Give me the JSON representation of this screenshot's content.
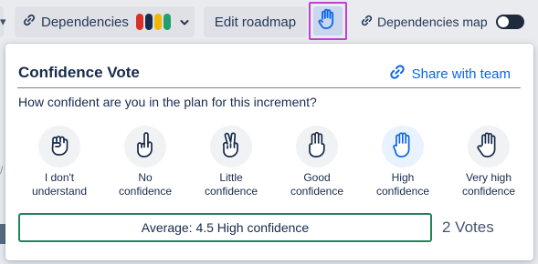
{
  "toolbar": {
    "edge_glyph": "▾",
    "dependencies_label": "Dependencies",
    "dependency_colors": [
      "#d93025",
      "#172b4d",
      "#f2b705",
      "#22a06b"
    ],
    "edit_roadmap_label": "Edit roadmap",
    "dependencies_map_label": "Dependencies map",
    "dependencies_map_enabled": false,
    "hand_button_color": "#0c66e4",
    "highlight_color": "#bf3fd4"
  },
  "background": {
    "sliver_glyph": "/"
  },
  "popup": {
    "title": "Confidence Vote",
    "share_label": "Share with team",
    "question": "How confident are you in the plan for this increment?",
    "options": [
      {
        "label": "I don't\nunderstand",
        "icon": "fist-icon",
        "selected": false
      },
      {
        "label": "No\nconfidence",
        "icon": "one-finger-icon",
        "selected": false
      },
      {
        "label": "Little\nconfidence",
        "icon": "two-fingers-icon",
        "selected": false
      },
      {
        "label": "Good\nconfidence",
        "icon": "three-fingers-icon",
        "selected": false
      },
      {
        "label": "High\nconfidence",
        "icon": "four-fingers-icon",
        "selected": true
      },
      {
        "label": "Very high\nconfidence",
        "icon": "five-fingers-icon",
        "selected": false
      }
    ],
    "average_text": "Average: 4.5 High confidence",
    "votes_text": "2 Votes",
    "accent_color": "#0c66e4",
    "average_border_color": "#1f845a"
  }
}
